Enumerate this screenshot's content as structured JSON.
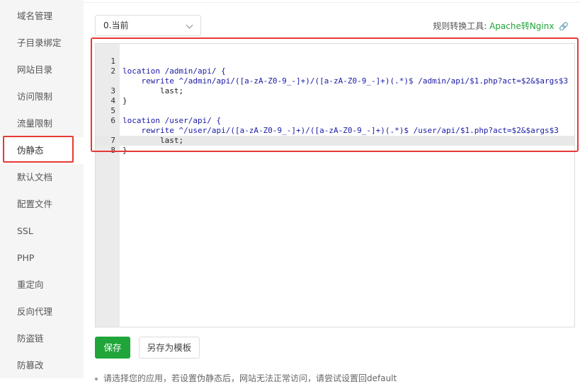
{
  "sidebar": {
    "items": [
      {
        "label": "域名管理"
      },
      {
        "label": "子目录绑定"
      },
      {
        "label": "网站目录"
      },
      {
        "label": "访问限制"
      },
      {
        "label": "流量限制"
      },
      {
        "label": "伪静态"
      },
      {
        "label": "默认文档"
      },
      {
        "label": "配置文件"
      },
      {
        "label": "SSL"
      },
      {
        "label": "PHP"
      },
      {
        "label": "重定向"
      },
      {
        "label": "反向代理"
      },
      {
        "label": "防盗链"
      },
      {
        "label": "防篡改"
      }
    ],
    "active": "伪静态"
  },
  "version_select": {
    "value": "0.当前"
  },
  "tool": {
    "label": "规则转换工具:",
    "link": "Apache转Nginx",
    "icon": "link-icon"
  },
  "editor": {
    "lines": [
      {
        "num": "1",
        "text": "location /admin/api/ {"
      },
      {
        "num": "2",
        "text": "    rewrite ^/admin/api/([a-zA-Z0-9_-]+)/([a-zA-Z0-9_-]+)(.*)$ /admin/api/$1.php?act=$2&$args$3"
      },
      {
        "num": "",
        "text": "        last;"
      },
      {
        "num": "3",
        "text": "}"
      },
      {
        "num": "4",
        "text": ""
      },
      {
        "num": "5",
        "text": "location /user/api/ {"
      },
      {
        "num": "6",
        "text": "    rewrite ^/user/api/([a-zA-Z0-9_-]+)/([a-zA-Z0-9_-]+)(.*)$ /user/api/$1.php?act=$2&$args$3"
      },
      {
        "num": "",
        "text": "        last;"
      },
      {
        "num": "7",
        "text": "}"
      },
      {
        "num": "8",
        "text": ""
      }
    ]
  },
  "buttons": {
    "save": "保存",
    "save_template": "另存为模板"
  },
  "note": "请选择您的应用，若设置伪静态后，网站无法正常访问，请尝试设置回default"
}
